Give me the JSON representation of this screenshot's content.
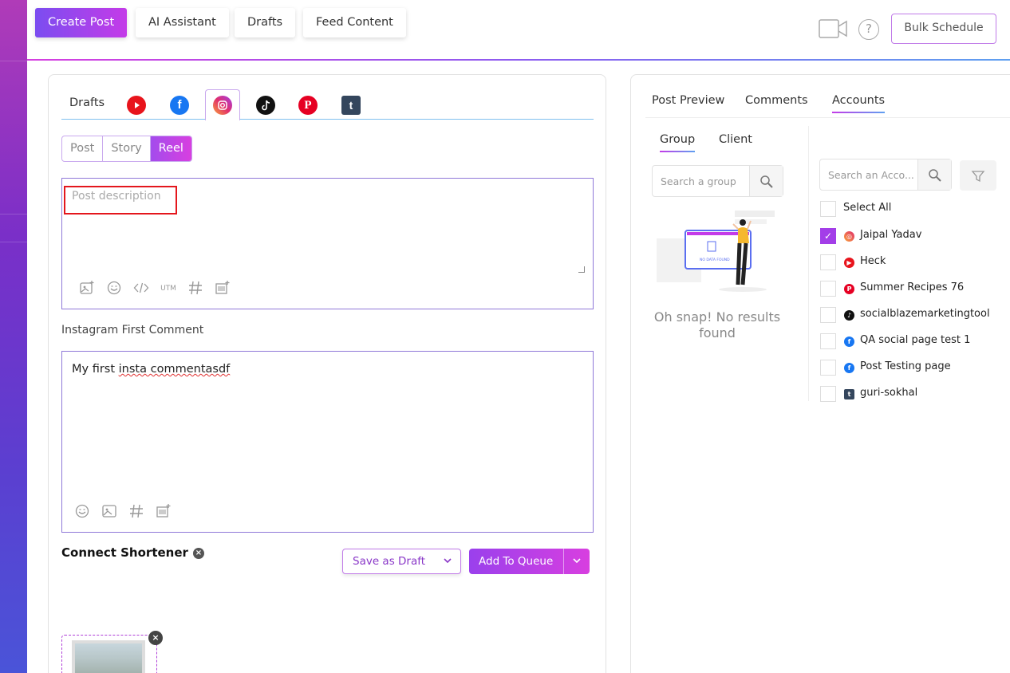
{
  "colors": {
    "brand_gradient_start": "#7b4df0",
    "brand_gradient_end": "#c43be8",
    "youtube": "#e8141c",
    "facebook": "#1877f2",
    "instagram": "#e1306c",
    "tiktok": "#111111",
    "pinterest": "#e60023",
    "tumblr": "#34465d",
    "highlight_red": "#e4161c"
  },
  "topbar": {
    "create_post": "Create Post",
    "ai_assistant": "AI Assistant",
    "drafts": "Drafts",
    "feed_content": "Feed Content",
    "help": "?",
    "bulk_schedule": "Bulk Schedule"
  },
  "composer": {
    "tabs": {
      "drafts": "Drafts",
      "networks": [
        "youtube-icon",
        "facebook-icon",
        "instagram-icon",
        "tiktok-icon",
        "pinterest-icon",
        "tumblr-icon"
      ]
    },
    "type_segments": [
      "Post",
      "Story",
      "Reel"
    ],
    "active_segment": "Reel",
    "description_placeholder": "Post description",
    "desc_tools": [
      "image-plus-icon",
      "emoji-icon",
      "code-icon",
      "UTM",
      "hashtag-icon",
      "media-library-icon"
    ],
    "first_comment_label": "Instagram First Comment",
    "first_comment_prefix": "My first ",
    "first_comment_misspelled": "insta commentasdf",
    "comment_tools": [
      "emoji-icon",
      "image-icon",
      "hashtag-icon",
      "media-library-icon"
    ],
    "connect_shortener": "Connect Shortener",
    "save_as_draft": "Save as Draft",
    "add_to_queue": "Add To Queue"
  },
  "preview": {
    "tabs": [
      "Post Preview",
      "Comments",
      "Accounts"
    ],
    "active_tab": "Accounts",
    "sub_tabs": [
      "Group",
      "Client"
    ],
    "active_sub_tab": "Group",
    "group_search_placeholder": "Search a group",
    "no_results": "Oh snap! No results found",
    "illustration_caption": "NO DATA FOUND",
    "account_search_placeholder": "Search an Acco...",
    "select_all": "Select All",
    "accounts": [
      {
        "name": "Jaipal Yadav",
        "network": "instagram",
        "checked": true
      },
      {
        "name": "Heck",
        "network": "youtube",
        "checked": false
      },
      {
        "name": "Summer Recipes 76",
        "network": "pinterest",
        "checked": false
      },
      {
        "name": "socialblazemarketingtool",
        "network": "tiktok",
        "checked": false
      },
      {
        "name": "QA social page test 1",
        "network": "facebook",
        "checked": false
      },
      {
        "name": "Post Testing page",
        "network": "facebook",
        "checked": false
      },
      {
        "name": "guri-sokhal",
        "network": "tumblr",
        "checked": false
      }
    ]
  }
}
